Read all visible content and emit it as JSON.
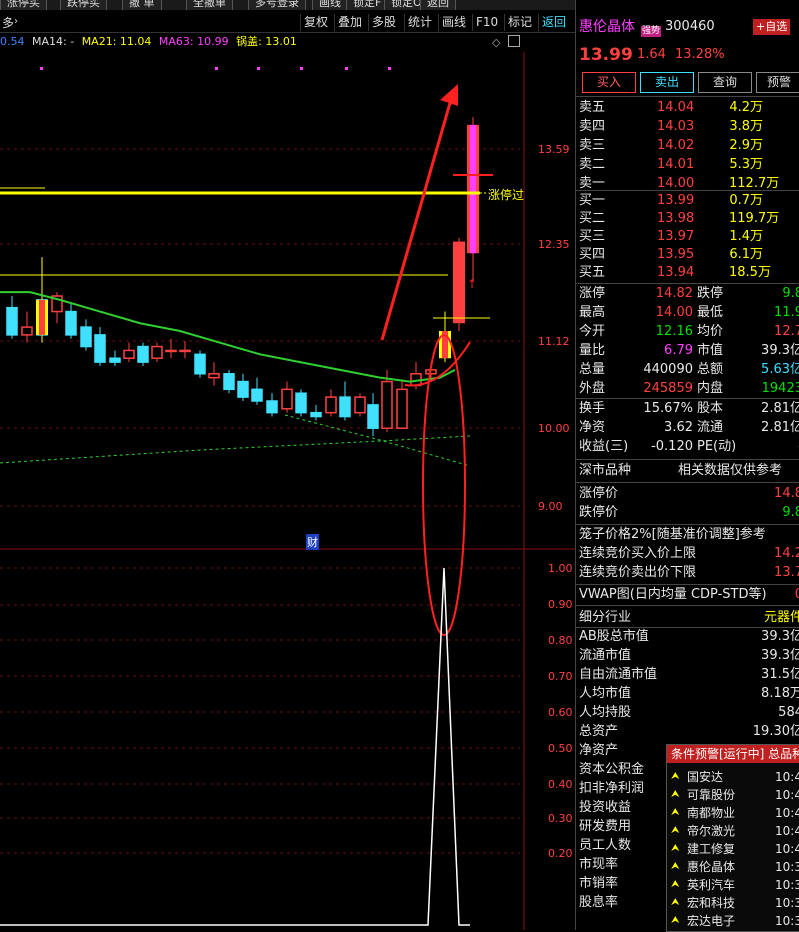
{
  "topbar": {
    "buttons": [
      "涨停买",
      "跌停买",
      "撤 单",
      "全撤单",
      "多号登录",
      "画线",
      "锁定F",
      "锁定O",
      "返回"
    ]
  },
  "menubar": {
    "items": [
      "复权",
      "叠加",
      "多股",
      "统计",
      "画线",
      "F10",
      "标记",
      "返回"
    ],
    "left_label": "多"
  },
  "ma_bar": {
    "ma_prefix": "0.54",
    "ma14_label": "MA14: -",
    "ma21_label": "MA21: 11.04",
    "ma63_label": "MA63: 10.99",
    "extra_label": "锅盖: 13.01"
  },
  "price_axis": [
    "13.59",
    "12.35",
    "11.12",
    "10.00",
    "9.00"
  ],
  "indicator_axis": [
    "1.00",
    "0.90",
    "0.80",
    "0.70",
    "0.60",
    "0.50",
    "0.40",
    "0.30",
    "0.20"
  ],
  "annotations": {
    "limit_line_label": "涨停过",
    "finance_marker": "财"
  },
  "colors": {
    "up": "#ff4040",
    "down": "#40e0ff",
    "ma_green": "#30d030",
    "limit": "#ffff00",
    "accent": "#ff2020"
  },
  "stock": {
    "name": "惠伦晶体",
    "tag": "强势",
    "code": "300460",
    "add_button": "+自选",
    "price": "13.99",
    "change": "1.64",
    "change_pct": "13.28%"
  },
  "trade_buttons": [
    "买入",
    "卖出",
    "查询",
    "预警"
  ],
  "sell_orders": [
    {
      "label": "卖五",
      "price": "14.04",
      "vol": "4.2万"
    },
    {
      "label": "卖四",
      "price": "14.03",
      "vol": "3.8万"
    },
    {
      "label": "卖三",
      "price": "14.02",
      "vol": "2.9万"
    },
    {
      "label": "卖二",
      "price": "14.01",
      "vol": "5.3万"
    },
    {
      "label": "卖一",
      "price": "14.00",
      "vol": "112.7万"
    }
  ],
  "buy_orders": [
    {
      "label": "买一",
      "price": "13.99",
      "vol": "0.7万"
    },
    {
      "label": "买二",
      "price": "13.98",
      "vol": "119.7万"
    },
    {
      "label": "买三",
      "price": "13.97",
      "vol": "1.4万"
    },
    {
      "label": "买四",
      "price": "13.95",
      "vol": "6.1万"
    },
    {
      "label": "买五",
      "price": "13.94",
      "vol": "18.5万"
    }
  ],
  "stats": [
    {
      "l1": "涨停",
      "v1": "14.82",
      "l2": "跌停",
      "v2": "9.8"
    },
    {
      "l1": "最高",
      "v1": "14.00",
      "l2": "最低",
      "v2": "11.9"
    },
    {
      "l1": "今开",
      "v1": "12.16",
      "l2": "均价",
      "v2": "12.7"
    },
    {
      "l1": "量比",
      "v1": "6.79",
      "l2": "市值",
      "v2": "39.3亿"
    },
    {
      "l1": "总量",
      "v1": "440090",
      "l2": "总额",
      "v2": "5.63亿"
    },
    {
      "l1": "外盘",
      "v1": "245859",
      "l2": "内盘",
      "v2": "19423"
    }
  ],
  "stats2": [
    {
      "l1": "换手",
      "v1": "15.67%",
      "l2": "股本",
      "v2": "2.81亿"
    },
    {
      "l1": "净资",
      "v1": "3.62",
      "l2": "流通",
      "v2": "2.81亿"
    },
    {
      "l1": "收益(三)",
      "v1": "-0.120",
      "l2": "PE(动)",
      "v2": "-"
    }
  ],
  "info_header": {
    "left": "深市品种",
    "right": "相关数据仅供参考"
  },
  "limit_rows": [
    {
      "label": "涨停价",
      "value": "14.8"
    },
    {
      "label": "跌停价",
      "value": "9.8"
    }
  ],
  "cage": {
    "title": "笼子价格2%[随基准价调整]参考",
    "rows": [
      {
        "label": "连续竞价买入价上限",
        "value": "14.2"
      },
      {
        "label": "连续竞价卖出价下限",
        "value": "13.7"
      }
    ]
  },
  "vwap": {
    "label": "VWAP图(日内均量 CDP-STD等)",
    "suffix": "0"
  },
  "industry": {
    "label": "细分行业",
    "value": "元器件"
  },
  "fundamentals": [
    {
      "label": "AB股总市值",
      "value": "39.3亿"
    },
    {
      "label": "流通市值",
      "value": "39.3亿"
    },
    {
      "label": "自由流通市值",
      "value": "31.5亿"
    },
    {
      "label": "人均市值",
      "value": "8.18万"
    },
    {
      "label": "人均持股",
      "value": "584"
    },
    {
      "label": "总资产",
      "value": "19.30亿"
    },
    {
      "label": "净资产",
      "value": ""
    },
    {
      "label": "资本公积金",
      "value": ""
    },
    {
      "label": "扣非净利润",
      "value": ""
    },
    {
      "label": "投资收益",
      "value": ""
    },
    {
      "label": "研发费用",
      "value": ""
    },
    {
      "label": "员工人数",
      "value": ""
    },
    {
      "label": "市现率",
      "value": ""
    },
    {
      "label": "市销率",
      "value": ""
    },
    {
      "label": "股息率",
      "value": ""
    }
  ],
  "alert_panel": {
    "title": "条件预警[运行中] 总品种",
    "items": [
      {
        "name": "国安达",
        "time": "10:4"
      },
      {
        "name": "可靠股份",
        "time": "10:4"
      },
      {
        "name": "南都物业",
        "time": "10:4"
      },
      {
        "name": "帝尔激光",
        "time": "10:4"
      },
      {
        "name": "建工修复",
        "time": "10:4"
      },
      {
        "name": "惠伦晶体",
        "time": "10:3"
      },
      {
        "name": "英利汽车",
        "time": "10:3"
      },
      {
        "name": "宏和科技",
        "time": "10:3"
      },
      {
        "name": "宏达电子",
        "time": "10:3"
      }
    ]
  }
}
